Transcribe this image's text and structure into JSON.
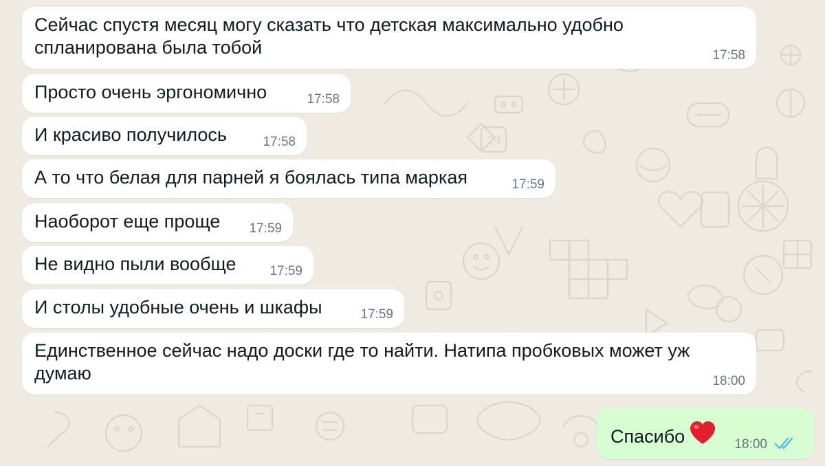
{
  "messages": [
    {
      "text": "Сейчас спустя месяц могу сказать что детская максимально удобно спланирована была тобой",
      "time": "17:58"
    },
    {
      "text": "Просто очень эргономично",
      "time": "17:58"
    },
    {
      "text": "И красиво получилось",
      "time": "17:58"
    },
    {
      "text": "А то что белая для парней я боялась типа маркая",
      "time": "17:59"
    },
    {
      "text": "Наоборот еще проще",
      "time": "17:59"
    },
    {
      "text": "Не видно пыли вообще",
      "time": "17:59"
    },
    {
      "text": "И столы удобные очень и шкафы",
      "time": "17:59"
    },
    {
      "text": "Единственное сейчас надо доски где то найти. Натипа пробковых может уж думаю",
      "time": "18:00"
    }
  ],
  "reply": {
    "text": "Спасибо",
    "time": "18:00",
    "emoji": "red-heart",
    "status": "read-double-check"
  },
  "colors": {
    "background": "#efeae2",
    "incoming_bubble": "#ffffff",
    "outgoing_bubble": "#d9fdd3",
    "read_ticks": "#53bdeb",
    "heart": "#e0202f"
  }
}
